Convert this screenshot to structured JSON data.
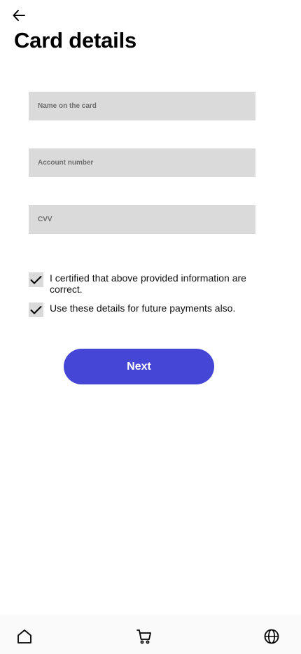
{
  "header": {
    "back_icon": "arrow-left-icon",
    "title": "Card details"
  },
  "form": {
    "name_placeholder": "Name on the card",
    "name_value": "",
    "account_placeholder": "Account number",
    "account_value": "",
    "cvv_placeholder": "CVV",
    "cvv_value": ""
  },
  "checkboxes": [
    {
      "label": "I certified that above provided information are correct.",
      "checked": true
    },
    {
      "label": "Use these details for future payments also.",
      "checked": true
    }
  ],
  "actions": {
    "next_label": "Next",
    "accent_color": "#4646d6"
  },
  "bottom_nav": {
    "items": [
      {
        "icon": "home-icon"
      },
      {
        "icon": "cart-icon"
      },
      {
        "icon": "globe-icon"
      }
    ]
  }
}
